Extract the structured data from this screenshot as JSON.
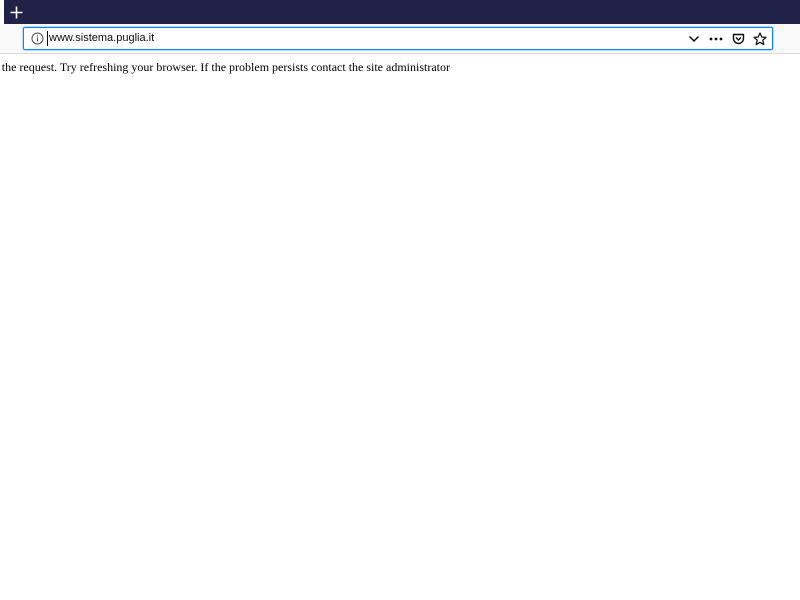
{
  "browser": {
    "tab_strip": {
      "new_tab_symbol": "+",
      "new_tab_icon": "plus-icon",
      "background_color": "#212247"
    },
    "address_bar": {
      "url": "www.sistema.puglia.it",
      "site_info_icon": "info-icon",
      "focus_color": "#0a84ff",
      "actions": [
        {
          "name": "url-dropdown",
          "icon": "chevron-down-icon"
        },
        {
          "name": "page-actions",
          "icon": "more-horizontal-icon"
        },
        {
          "name": "save-to-pocket",
          "icon": "pocket-icon"
        },
        {
          "name": "bookmark",
          "icon": "star-icon"
        }
      ]
    }
  },
  "page": {
    "message": "ng the request. Try refreshing your browser. If the problem persists contact the site administrator"
  }
}
